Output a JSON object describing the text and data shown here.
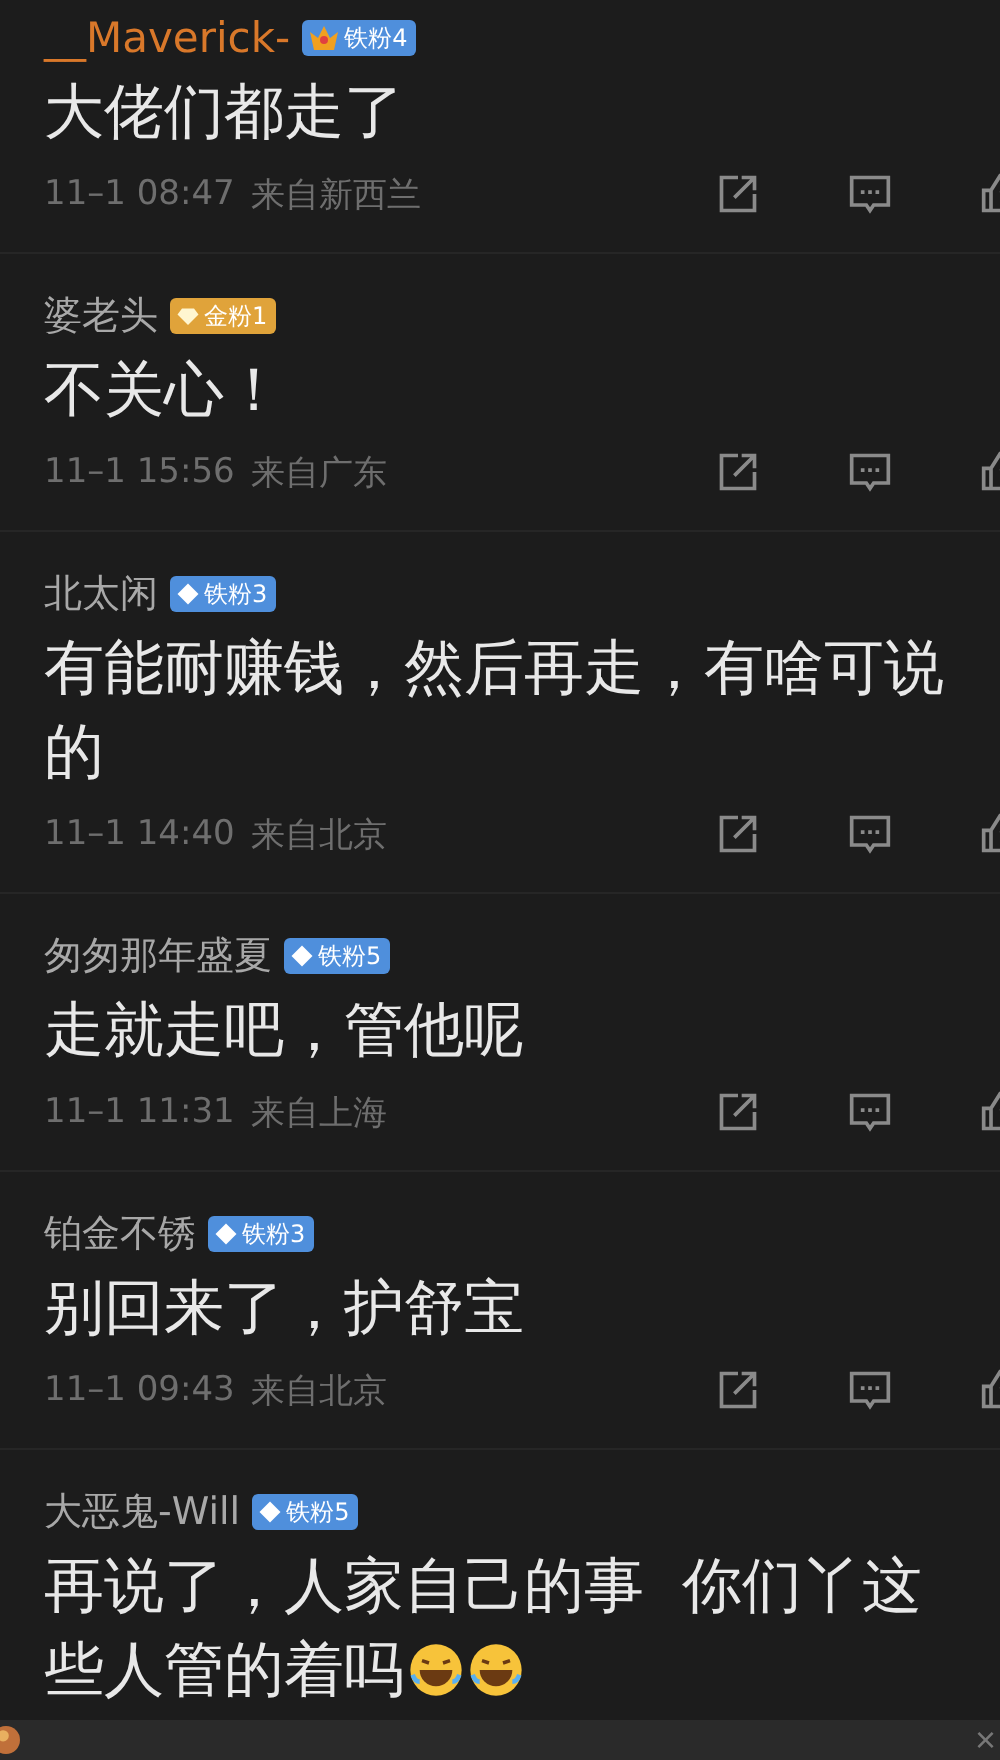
{
  "comments": [
    {
      "name": "__Maverick-",
      "highlighted": true,
      "badge": {
        "kind": "crown",
        "label": "铁粉4"
      },
      "text": "大佬们都走了",
      "date": "11–1 08:47",
      "location": "来自新西兰"
    },
    {
      "name": "婆老头",
      "highlighted": false,
      "badge": {
        "kind": "gold",
        "label": "金粉1"
      },
      "text": "不关心！",
      "date": "11–1 15:56",
      "location": "来自广东"
    },
    {
      "name": "北太闲",
      "highlighted": false,
      "badge": {
        "kind": "iron",
        "label": "铁粉3"
      },
      "text": "有能耐赚钱，然后再走，有啥可说的",
      "date": "11–1 14:40",
      "location": "来自北京"
    },
    {
      "name": "匆匆那年盛夏",
      "highlighted": false,
      "badge": {
        "kind": "iron",
        "label": "铁粉5"
      },
      "text": "走就走吧，管他呢",
      "date": "11–1 11:31",
      "location": "来自上海"
    },
    {
      "name": "铂金不锈",
      "highlighted": false,
      "badge": {
        "kind": "iron",
        "label": "铁粉3"
      },
      "text": "别回来了，护舒宝",
      "date": "11–1 09:43",
      "location": "来自北京"
    },
    {
      "name": "大恶鬼-Will",
      "highlighted": false,
      "badge": {
        "kind": "iron",
        "label": "铁粉5"
      },
      "text": "再说了，人家自己的事  你们丫这些人管的着吗",
      "emojis": [
        {
          "kind": "laugh"
        },
        {
          "kind": "laugh"
        }
      ]
    }
  ],
  "bottom_bar": {
    "close": "×"
  }
}
